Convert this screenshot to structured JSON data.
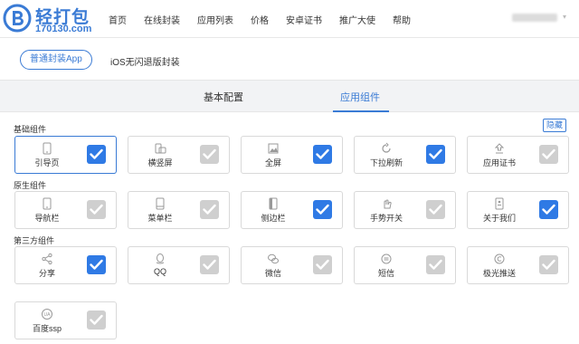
{
  "header": {
    "logo_text": "轻打包",
    "logo_url": "170130.com",
    "nav": [
      "首页",
      "在线封装",
      "应用列表",
      "价格",
      "安卓证书",
      "推广大使",
      "帮助"
    ]
  },
  "modes": {
    "selected": "普通封装App",
    "other": "iOS无闪退版封装"
  },
  "tabs": [
    "基本配置",
    "应用组件"
  ],
  "active_tab": "应用组件",
  "hide_label": "隐藏",
  "sections": [
    {
      "label": "基础组件",
      "items": [
        {
          "label": "引导页",
          "icon": "phone-icon",
          "checked": true,
          "selected": true
        },
        {
          "label": "横竖屏",
          "icon": "rotate-icon",
          "checked": false,
          "selected": false
        },
        {
          "label": "全屏",
          "icon": "image-icon",
          "checked": true,
          "selected": false
        },
        {
          "label": "下拉刷新",
          "icon": "refresh-icon",
          "checked": true,
          "selected": false
        },
        {
          "label": "应用证书",
          "icon": "upload-icon",
          "checked": false,
          "selected": false
        }
      ]
    },
    {
      "label": "原生组件",
      "items": [
        {
          "label": "导航栏",
          "icon": "phone-icon",
          "checked": false,
          "selected": false
        },
        {
          "label": "菜单栏",
          "icon": "menu-phone-icon",
          "checked": false,
          "selected": false
        },
        {
          "label": "侧边栏",
          "icon": "sidebar-icon",
          "checked": true,
          "selected": false
        },
        {
          "label": "手势开关",
          "icon": "hand-icon",
          "checked": false,
          "selected": false
        },
        {
          "label": "关于我们",
          "icon": "about-icon",
          "checked": true,
          "selected": false
        }
      ]
    },
    {
      "label": "第三方组件",
      "items": [
        {
          "label": "分享",
          "icon": "share-icon",
          "checked": true,
          "selected": false
        },
        {
          "label": "QQ",
          "icon": "qq-icon",
          "checked": false,
          "selected": false
        },
        {
          "label": "微信",
          "icon": "wechat-icon",
          "checked": false,
          "selected": false
        },
        {
          "label": "短信",
          "icon": "sms-icon",
          "checked": false,
          "selected": false
        },
        {
          "label": "极光推送",
          "icon": "copyright-icon",
          "checked": false,
          "selected": false
        },
        {
          "label": "百度ssp",
          "icon": "ua-icon",
          "checked": false,
          "selected": false
        }
      ]
    }
  ],
  "colors": {
    "accent": "#3a7bd5",
    "checkbox_on": "#2f7ae5",
    "checkbox_off": "#cfcfcf",
    "tab_bar": "#f2f3f5"
  }
}
